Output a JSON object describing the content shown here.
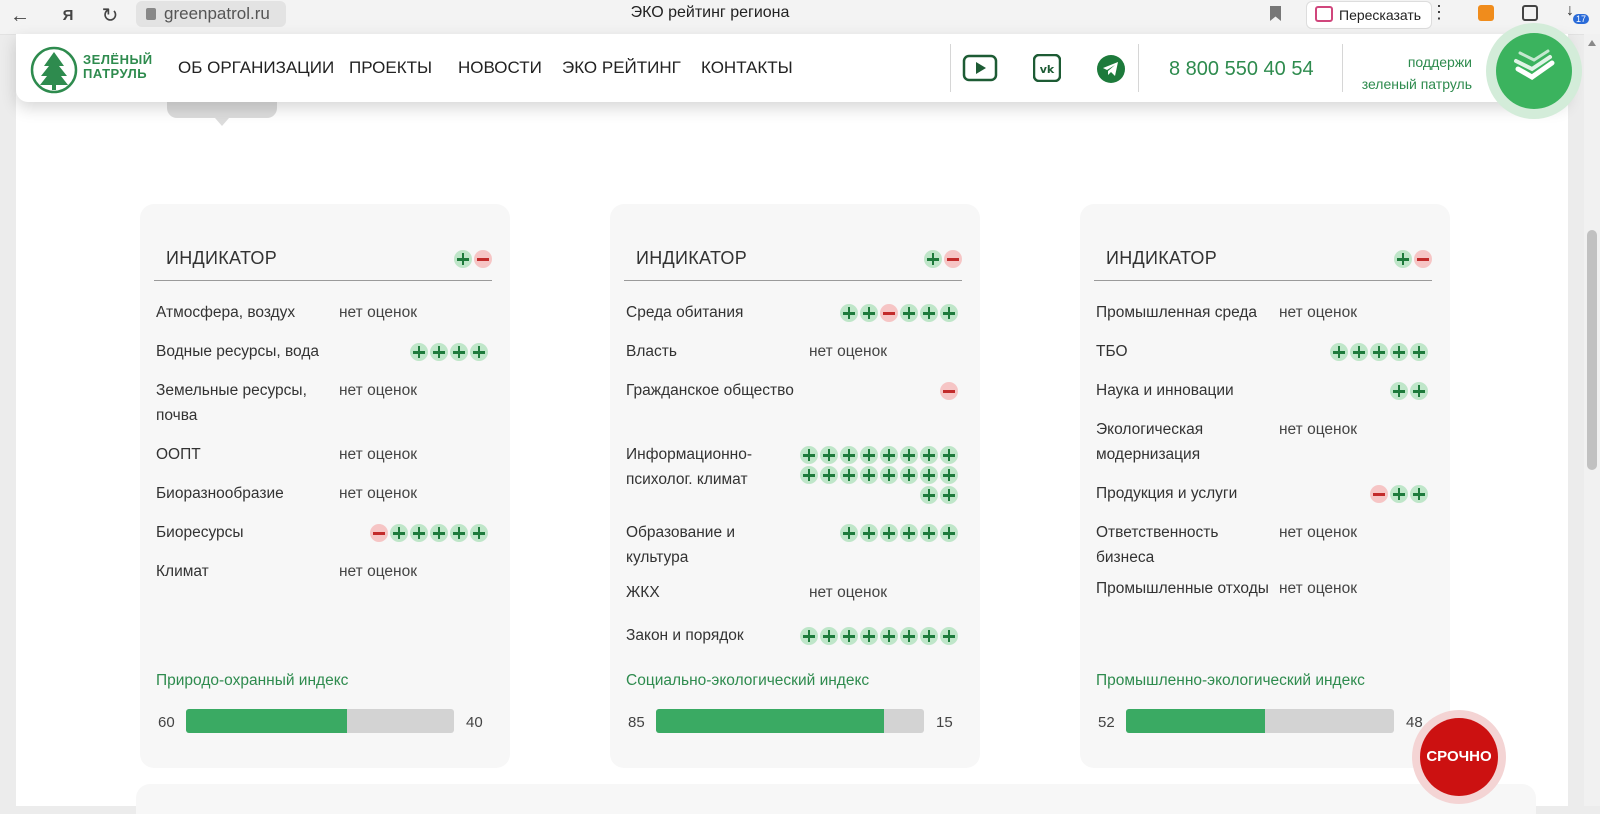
{
  "browser": {
    "url": "greenpatrol.ru",
    "tab_title": "ЭКО рейтинг региона",
    "retell_label": "Пересказать",
    "downloads_badge": "17"
  },
  "header": {
    "logo_line1": "ЗЕЛЁНЫЙ",
    "logo_line2": "ПАТРУЛЬ",
    "menu": [
      "ОБ ОРГАНИЗАЦИИ",
      "ПРОЕКТЫ",
      "НОВОСТИ",
      "ЭКО РЕЙТИНГ",
      "КОНТАКТЫ"
    ],
    "social": [
      "youtube-icon",
      "vk-icon",
      "telegram-icon"
    ],
    "phone": "8 800 550 40 54",
    "support_line1": "поддержи",
    "support_line2": "зеленый патруль",
    "accent": "#2e8b4e"
  },
  "cards": [
    {
      "header": "ИНДИКАТОР",
      "rows": [
        {
          "label": "Атмосфера, воздух",
          "status": "нет оценок",
          "marks": []
        },
        {
          "label": "Водные ресурсы, вода",
          "status": "",
          "marks": [
            "+",
            "+",
            "+",
            "+"
          ]
        },
        {
          "label": "Земельные ресурсы, почва",
          "status": "нет оценок",
          "marks": []
        },
        {
          "label": "ООПТ",
          "status": "нет оценок",
          "marks": []
        },
        {
          "label": "Биоразнообразие",
          "status": "нет оценок",
          "marks": []
        },
        {
          "label": "Биоресурсы",
          "status": "",
          "marks": [
            "-",
            "+",
            "+",
            "+",
            "+",
            "+"
          ]
        },
        {
          "label": "Климат",
          "status": "нет оценок",
          "marks": []
        }
      ],
      "index_title": "Природо-охранный индекс",
      "index_left": 60,
      "index_right": 40
    },
    {
      "header": "ИНДИКАТОР",
      "rows": [
        {
          "label": "Среда обитания",
          "status": "",
          "marks": [
            "+",
            "+",
            "-",
            "+",
            "+",
            "+"
          ]
        },
        {
          "label": "Власть",
          "status": "нет оценок",
          "marks": []
        },
        {
          "label": "Гражданское общество",
          "status": "",
          "marks": [
            "-"
          ]
        },
        {
          "label": "Информационно-психолог. климат",
          "status": "",
          "marks": [
            "+",
            "+",
            "+",
            "+",
            "+",
            "+",
            "+",
            "+",
            "+",
            "+",
            "+",
            "+",
            "+",
            "+",
            "+",
            "+",
            "+",
            "+"
          ]
        },
        {
          "label": "Образование и культура",
          "status": "",
          "marks": [
            "+",
            "+",
            "+",
            "+",
            "+",
            "+"
          ]
        },
        {
          "label": "ЖКХ",
          "status": "нет оценок",
          "marks": []
        },
        {
          "label": "Закон и порядок",
          "status": "",
          "marks": [
            "+",
            "+",
            "+",
            "+",
            "+",
            "+",
            "+",
            "+"
          ]
        }
      ],
      "index_title": "Социально-экологический индекс",
      "index_left": 85,
      "index_right": 15
    },
    {
      "header": "ИНДИКАТОР",
      "rows": [
        {
          "label": "Промышленная среда",
          "status": "нет оценок",
          "marks": []
        },
        {
          "label": "ТБО",
          "status": "",
          "marks": [
            "+",
            "+",
            "+",
            "+",
            "+"
          ]
        },
        {
          "label": "Наука и инновации",
          "status": "",
          "marks": [
            "+",
            "+"
          ]
        },
        {
          "label": "Экологическая модернизация",
          "status": "нет оценок",
          "marks": []
        },
        {
          "label": "Продукция и услуги",
          "status": "",
          "marks": [
            "-",
            "+",
            "+"
          ]
        },
        {
          "label": "Ответственность бизнеса",
          "status": "нет оценок",
          "marks": []
        },
        {
          "label": "Промышленные отходы",
          "status": "нет оценок",
          "marks": []
        }
      ],
      "index_title": "Промышленно-экологический индекс",
      "index_left": 52,
      "index_right": 48
    }
  ],
  "urgent_label": "СРОЧНО"
}
